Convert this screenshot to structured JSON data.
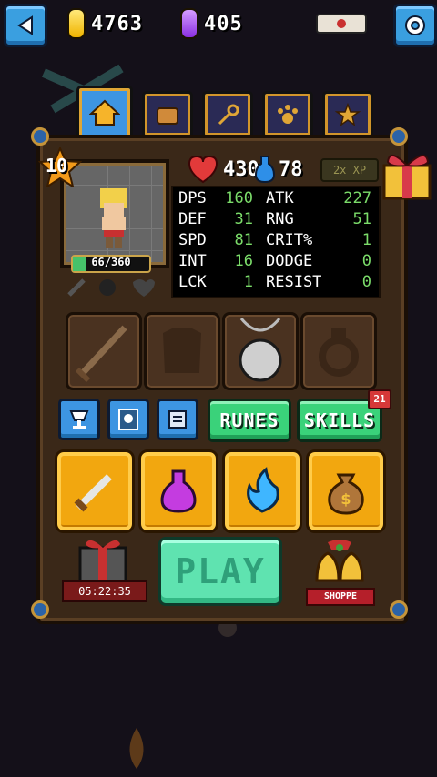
{
  "currency": {
    "gold": "4763",
    "gems": "405"
  },
  "hero": {
    "level": "10",
    "hp": "66/360",
    "hp_fraction": 0.18,
    "health": "430",
    "mana": "78",
    "xp_boost": "2x XP"
  },
  "stats": [
    {
      "label": "DPS",
      "value": "160",
      "label2": "ATK",
      "value2": "227"
    },
    {
      "label": "DEF",
      "value": "31",
      "label2": "RNG",
      "value2": "51"
    },
    {
      "label": "SPD",
      "value": "81",
      "label2": "CRIT%",
      "value2": "1"
    },
    {
      "label": "INT",
      "value": "16",
      "label2": "DODGE",
      "value2": "0"
    },
    {
      "label": "LCK",
      "value": "1",
      "label2": "RESIST",
      "value2": "0"
    }
  ],
  "buttons": {
    "runes": "RUNES",
    "skills": "SKILLS",
    "skills_badge": "21",
    "play": "PLAY"
  },
  "gift_timer": "05:22:35",
  "shoppe": "SHOPPE",
  "icons": {
    "tabs": [
      "home-icon",
      "bag-icon",
      "key-icon",
      "paw-icon",
      "star-icon"
    ],
    "equipment": [
      "sword-slot-icon",
      "armor-slot-icon",
      "amulet-slot-icon",
      "ring-slot-icon"
    ],
    "actions": [
      "sword-icon",
      "potion-icon",
      "flame-icon",
      "money-bag-icon"
    ]
  }
}
